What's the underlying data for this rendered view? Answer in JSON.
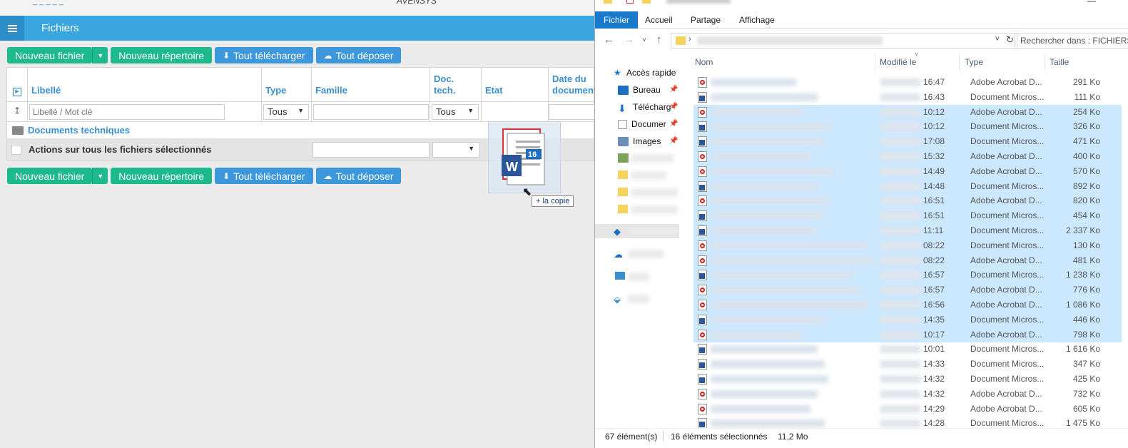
{
  "web": {
    "header_partial": "AVENSYS",
    "appbar_title": "Fichiers",
    "buttons": {
      "new_file": "Nouveau fichier",
      "new_folder": "Nouveau répertoire",
      "download_all": "Tout télécharger",
      "upload_all": "Tout déposer"
    },
    "columns": {
      "libelle": "Libellé",
      "type": "Type",
      "famille": "Famille",
      "doc_tech": "Doc.\ntech.",
      "etat": "Etat",
      "date": "Date du\ndocument"
    },
    "filters": {
      "search_placeholder": "Libellé / Mot clé",
      "type_value": "Tous",
      "doc_tech_value": "Tous"
    },
    "folder_row": "Documents techniques",
    "actions_row": "Actions sur tous les fichiers sélectionnés",
    "drag": {
      "badge_count": "16",
      "tooltip": "+ la copie"
    },
    "colors": {
      "appbar": "#3aa6df",
      "green_button": "#1fb98e",
      "blue_button": "#3c97dc",
      "header_text": "#3a8fd0"
    }
  },
  "explorer": {
    "ribbon_tabs": [
      "Fichier",
      "Accueil",
      "Partage",
      "Affichage"
    ],
    "search_placeholder": "Rechercher dans : FICHIERS",
    "nav_items": [
      {
        "label": "Accès rapide",
        "icon": "star-icon"
      },
      {
        "label": "Bureau",
        "icon": "desktop-icon",
        "pinned": true
      },
      {
        "label": "Télécharg",
        "icon": "download-icon",
        "pinned": true
      },
      {
        "label": "Documer",
        "icon": "documents-icon",
        "pinned": true
      },
      {
        "label": "Images",
        "icon": "images-icon",
        "pinned": true
      }
    ],
    "columns": {
      "name": "Nom",
      "modified": "Modifié le",
      "type": "Type",
      "size": "Taille"
    },
    "files": [
      {
        "kind": "pdf",
        "time": "16:47",
        "type": "Adobe Acrobat D...",
        "size": "291 Ko",
        "selected": false
      },
      {
        "kind": "doc",
        "time": "16:43",
        "type": "Document Micros...",
        "size": "111 Ko",
        "selected": false
      },
      {
        "kind": "pdf",
        "time": "10:12",
        "type": "Adobe Acrobat D...",
        "size": "254 Ko",
        "selected": true
      },
      {
        "kind": "doc",
        "time": "10:12",
        "type": "Document Micros...",
        "size": "326 Ko",
        "selected": true
      },
      {
        "kind": "doc",
        "time": "17:08",
        "type": "Document Micros...",
        "size": "471 Ko",
        "selected": true
      },
      {
        "kind": "pdf",
        "time": "15:32",
        "type": "Adobe Acrobat D...",
        "size": "400 Ko",
        "selected": true
      },
      {
        "kind": "pdf",
        "time": "14:49",
        "type": "Adobe Acrobat D...",
        "size": "570 Ko",
        "selected": true
      },
      {
        "kind": "doc",
        "time": "14:48",
        "type": "Document Micros...",
        "size": "892 Ko",
        "selected": true
      },
      {
        "kind": "pdf",
        "time": "16:51",
        "type": "Adobe Acrobat D...",
        "size": "820 Ko",
        "selected": true
      },
      {
        "kind": "doc",
        "time": "16:51",
        "type": "Document Micros...",
        "size": "454 Ko",
        "selected": true
      },
      {
        "kind": "doc",
        "time": "11:11",
        "type": "Document Micros...",
        "size": "2 337 Ko",
        "selected": true
      },
      {
        "kind": "pdf",
        "time": "08:22",
        "type": "Document Micros...",
        "size": "130 Ko",
        "selected": true
      },
      {
        "kind": "pdf",
        "time": "08:22",
        "type": "Adobe Acrobat D...",
        "size": "481 Ko",
        "selected": true
      },
      {
        "kind": "doc",
        "time": "16:57",
        "type": "Document Micros...",
        "size": "1 238 Ko",
        "selected": true
      },
      {
        "kind": "pdf",
        "time": "16:57",
        "type": "Adobe Acrobat D...",
        "size": "776 Ko",
        "selected": true
      },
      {
        "kind": "pdf",
        "time": "16:56",
        "type": "Adobe Acrobat D...",
        "size": "1 086 Ko",
        "selected": true
      },
      {
        "kind": "doc",
        "time": "14:35",
        "type": "Document Micros...",
        "size": "446 Ko",
        "selected": true
      },
      {
        "kind": "pdf",
        "time": "10:17",
        "type": "Adobe Acrobat D...",
        "size": "798 Ko",
        "selected": true
      },
      {
        "kind": "doc",
        "time": "10:01",
        "type": "Document Micros...",
        "size": "1 616 Ko",
        "selected": false
      },
      {
        "kind": "doc",
        "time": "14:33",
        "type": "Document Micros...",
        "size": "347 Ko",
        "selected": false
      },
      {
        "kind": "doc",
        "time": "14:32",
        "type": "Document Micros...",
        "size": "425 Ko",
        "selected": false
      },
      {
        "kind": "pdf",
        "time": "14:32",
        "type": "Adobe Acrobat D...",
        "size": "732 Ko",
        "selected": false
      },
      {
        "kind": "pdf",
        "time": "14:29",
        "type": "Adobe Acrobat D...",
        "size": "605 Ko",
        "selected": false
      },
      {
        "kind": "doc",
        "time": "14:28",
        "type": "Document Micros...",
        "size": "1 475 Ko",
        "selected": false
      }
    ],
    "status": {
      "count": "67 élément(s)",
      "selected": "16 éléments sélectionnés",
      "selected_size": "11,2 Mo"
    },
    "colors": {
      "ribbon_active": "#1979ca",
      "selection": "#cce8ff"
    }
  }
}
